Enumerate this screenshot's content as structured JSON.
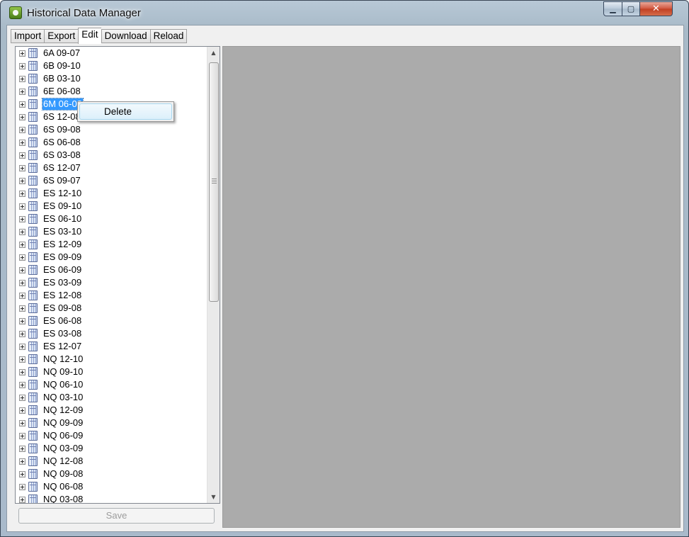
{
  "window": {
    "title": "Historical Data Manager",
    "controls": {
      "minimize": "▁",
      "maximize": "▢",
      "close": "✕"
    }
  },
  "tabs": [
    {
      "label": "Import"
    },
    {
      "label": "Export"
    },
    {
      "label": "Edit",
      "selected": true
    },
    {
      "label": "Download"
    },
    {
      "label": "Reload"
    }
  ],
  "tree": {
    "items": [
      "6A 09-07",
      "6B 09-10",
      "6B 03-10",
      "6E 06-08",
      "6M 06-08",
      "6S 12-08",
      "6S 09-08",
      "6S 06-08",
      "6S 03-08",
      "6S 12-07",
      "6S 09-07",
      "ES 12-10",
      "ES 09-10",
      "ES 06-10",
      "ES 03-10",
      "ES 12-09",
      "ES 09-09",
      "ES 06-09",
      "ES 03-09",
      "ES 12-08",
      "ES 09-08",
      "ES 06-08",
      "ES 03-08",
      "ES 12-07",
      "NQ 12-10",
      "NQ 09-10",
      "NQ 06-10",
      "NQ 03-10",
      "NQ 12-09",
      "NQ 09-09",
      "NQ 06-09",
      "NQ 03-09",
      "NQ 12-08",
      "NQ 09-08",
      "NQ 06-08",
      "NQ 03-08"
    ],
    "selected_index": 4,
    "item_icon": "database-icon",
    "expander_icon": "plus-expander-icon"
  },
  "context_menu": {
    "items": [
      {
        "label": "Delete"
      }
    ]
  },
  "save_button": {
    "label": "Save",
    "enabled": false
  },
  "colors": {
    "selection": "#3399ff",
    "content_background": "#ababab",
    "menu_highlight": "#dcf0fb"
  }
}
